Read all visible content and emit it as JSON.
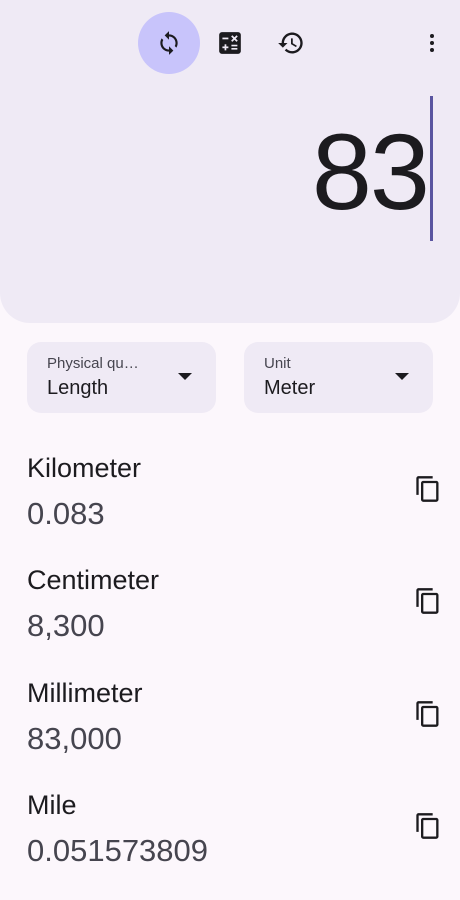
{
  "toolbar": {
    "converter_icon": "sync-icon",
    "calculator_icon": "calculator-icon",
    "history_icon": "history-icon",
    "more_icon": "more-vert-icon",
    "active_color": "#c8c4fb"
  },
  "display": {
    "value": "83"
  },
  "selectors": {
    "quantity": {
      "label": "Physical qu…",
      "value": "Length"
    },
    "unit": {
      "label": "Unit",
      "value": "Meter"
    }
  },
  "results": [
    {
      "name": "Kilometer",
      "value": "0.083"
    },
    {
      "name": "Centimeter",
      "value": "8,300"
    },
    {
      "name": "Millimeter",
      "value": "83,000"
    },
    {
      "name": "Mile",
      "value": "0.051573809"
    }
  ],
  "colors": {
    "panel_bg": "#efeaf5",
    "page_bg": "#fcf7fc",
    "cursor": "#5a55a0"
  }
}
